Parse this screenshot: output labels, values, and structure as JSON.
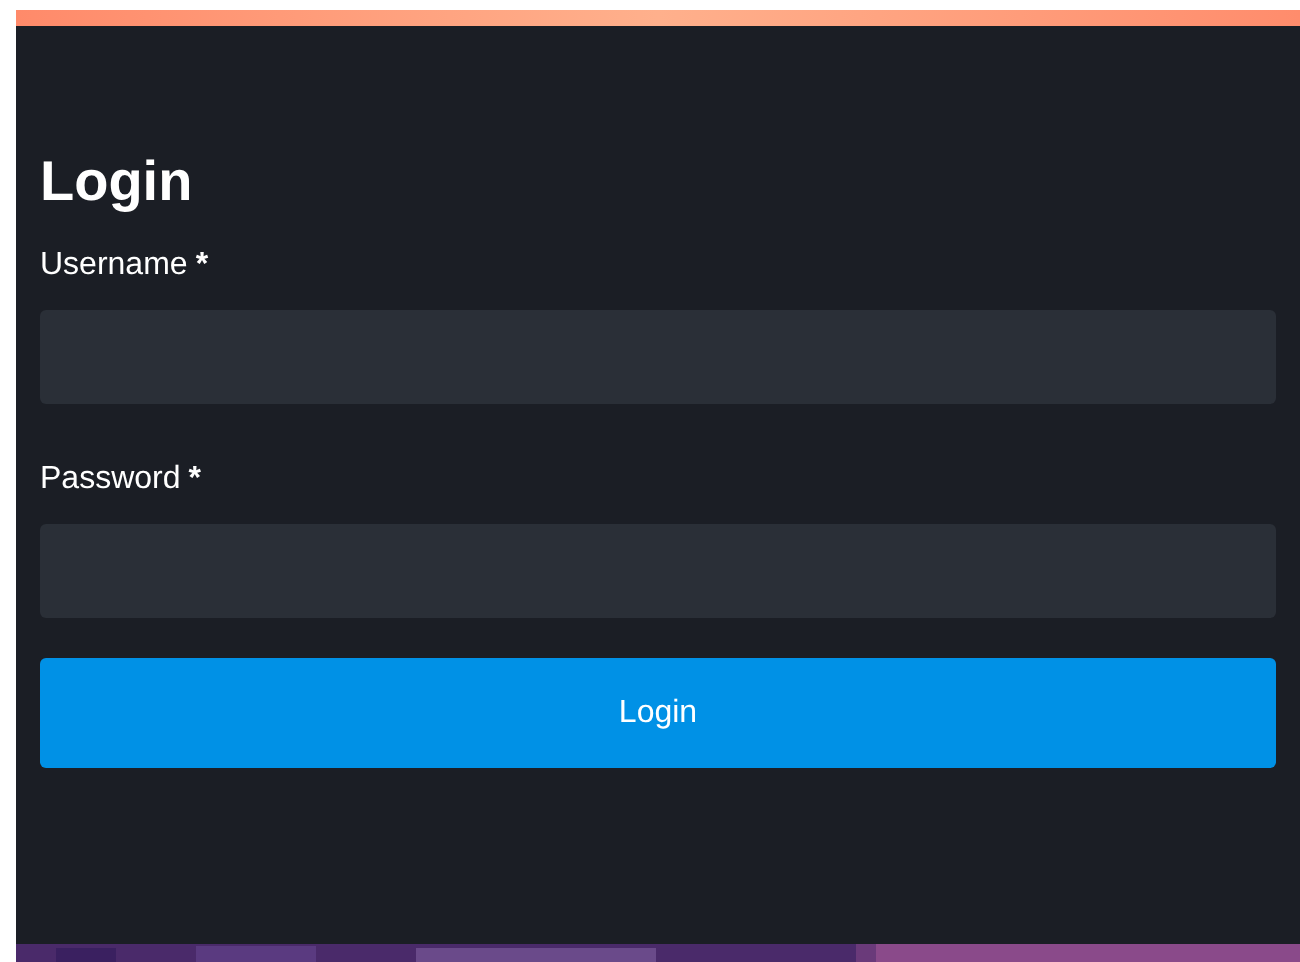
{
  "title": "Login",
  "fields": [
    {
      "label": "Username",
      "required_mark": "*"
    },
    {
      "label": "Password",
      "required_mark": "*"
    }
  ],
  "submit_button": "Login"
}
